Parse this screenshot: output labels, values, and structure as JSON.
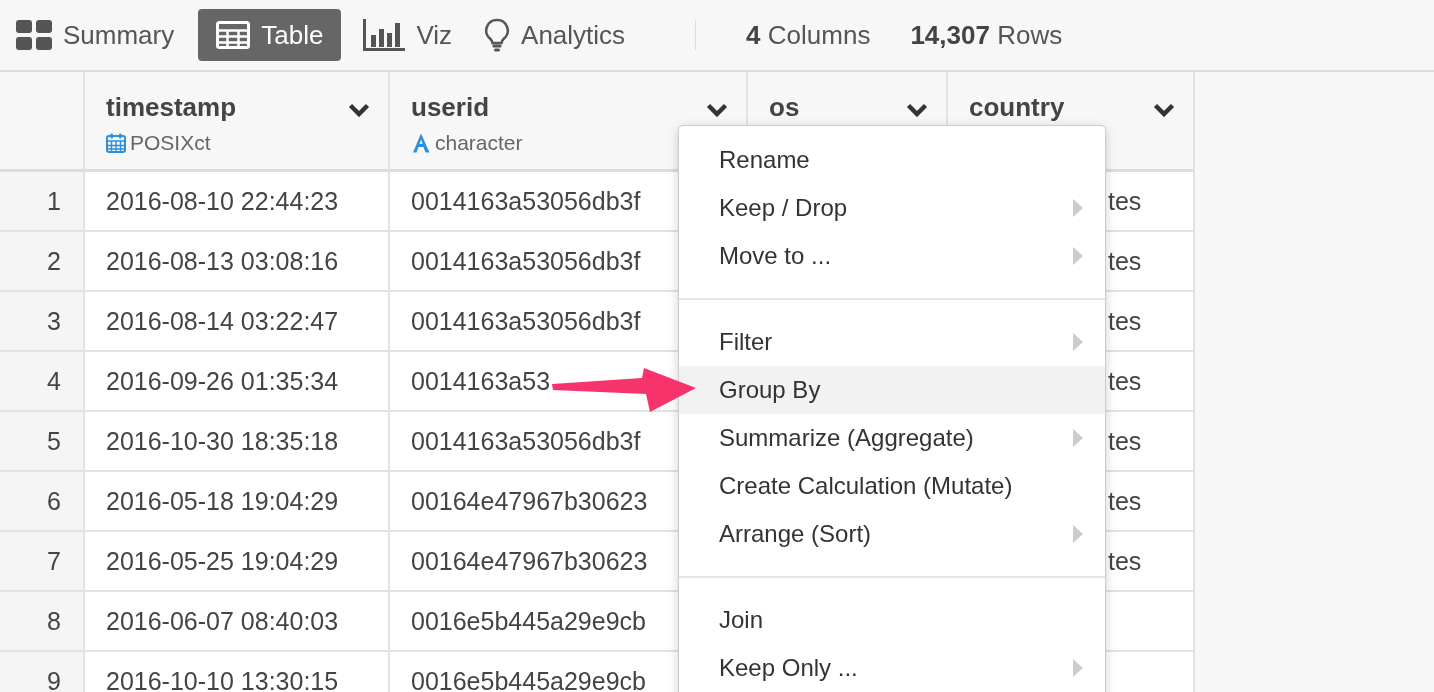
{
  "toolbar": {
    "tabs": [
      {
        "label": "Summary",
        "kind": "summary",
        "selected": false
      },
      {
        "label": "Table",
        "kind": "table",
        "selected": true
      },
      {
        "label": "Viz",
        "kind": "viz",
        "selected": false
      },
      {
        "label": "Analytics",
        "kind": "analytics",
        "selected": false
      }
    ],
    "stats": [
      "**4** Columns",
      "**14,307** Rows"
    ]
  },
  "table": {
    "columns": [
      {
        "name": "timestamp",
        "type": "POSIXct",
        "kind": "datetime"
      },
      {
        "name": "userid",
        "type": "character",
        "kind": "character"
      },
      {
        "name": "os"
      },
      {
        "name": "country"
      }
    ],
    "rows": [
      {
        "number": "1",
        "timestamp": "2016-08-10 22:44:23",
        "userid": "0014163a53056db3f",
        "country": "tes"
      },
      {
        "number": "2",
        "timestamp": "2016-08-13 03:08:16",
        "userid": "0014163a53056db3f",
        "country": "tes"
      },
      {
        "number": "3",
        "timestamp": "2016-08-14 03:22:47",
        "userid": "0014163a53056db3f",
        "country": "tes"
      },
      {
        "number": "4",
        "timestamp": "2016-09-26 01:35:34",
        "userid": "0014163a53",
        "country": "tes"
      },
      {
        "number": "5",
        "timestamp": "2016-10-30 18:35:18",
        "userid": "0014163a53056db3f",
        "country": "tes"
      },
      {
        "number": "6",
        "timestamp": "2016-05-18 19:04:29",
        "userid": "00164e47967b30623",
        "country": "tes"
      },
      {
        "number": "7",
        "timestamp": "2016-05-25 19:04:29",
        "userid": "00164e47967b30623",
        "country": "tes"
      },
      {
        "number": "8",
        "timestamp": "2016-06-07 08:40:03",
        "userid": "0016e5b445a29e9cb"
      },
      {
        "number": "9",
        "timestamp": "2016-10-10 13:30:15",
        "userid": "0016e5b445a29e9cb"
      }
    ]
  },
  "menu": {
    "items": [
      {
        "kind": "item",
        "label": "Rename",
        "submenu": false,
        "selected": false
      },
      {
        "kind": "item",
        "label": "Keep / Drop",
        "submenu": true,
        "selected": false
      },
      {
        "kind": "item",
        "label": "Move to ...",
        "submenu": true,
        "selected": false
      },
      {
        "kind": "divider"
      },
      {
        "kind": "item",
        "label": "Filter",
        "submenu": true,
        "selected": false
      },
      {
        "kind": "item",
        "label": "Group By",
        "submenu": false,
        "selected": true
      },
      {
        "kind": "item",
        "label": "Summarize (Aggregate)",
        "submenu": true,
        "selected": false
      },
      {
        "kind": "item",
        "label": "Create Calculation (Mutate)",
        "submenu": false,
        "selected": false
      },
      {
        "kind": "item",
        "label": "Arrange (Sort)",
        "submenu": true,
        "selected": false
      },
      {
        "kind": "divider"
      },
      {
        "kind": "item",
        "label": "Join",
        "submenu": false,
        "selected": false
      },
      {
        "kind": "item",
        "label": "Keep Only ...",
        "submenu": true,
        "selected": false
      }
    ]
  }
}
